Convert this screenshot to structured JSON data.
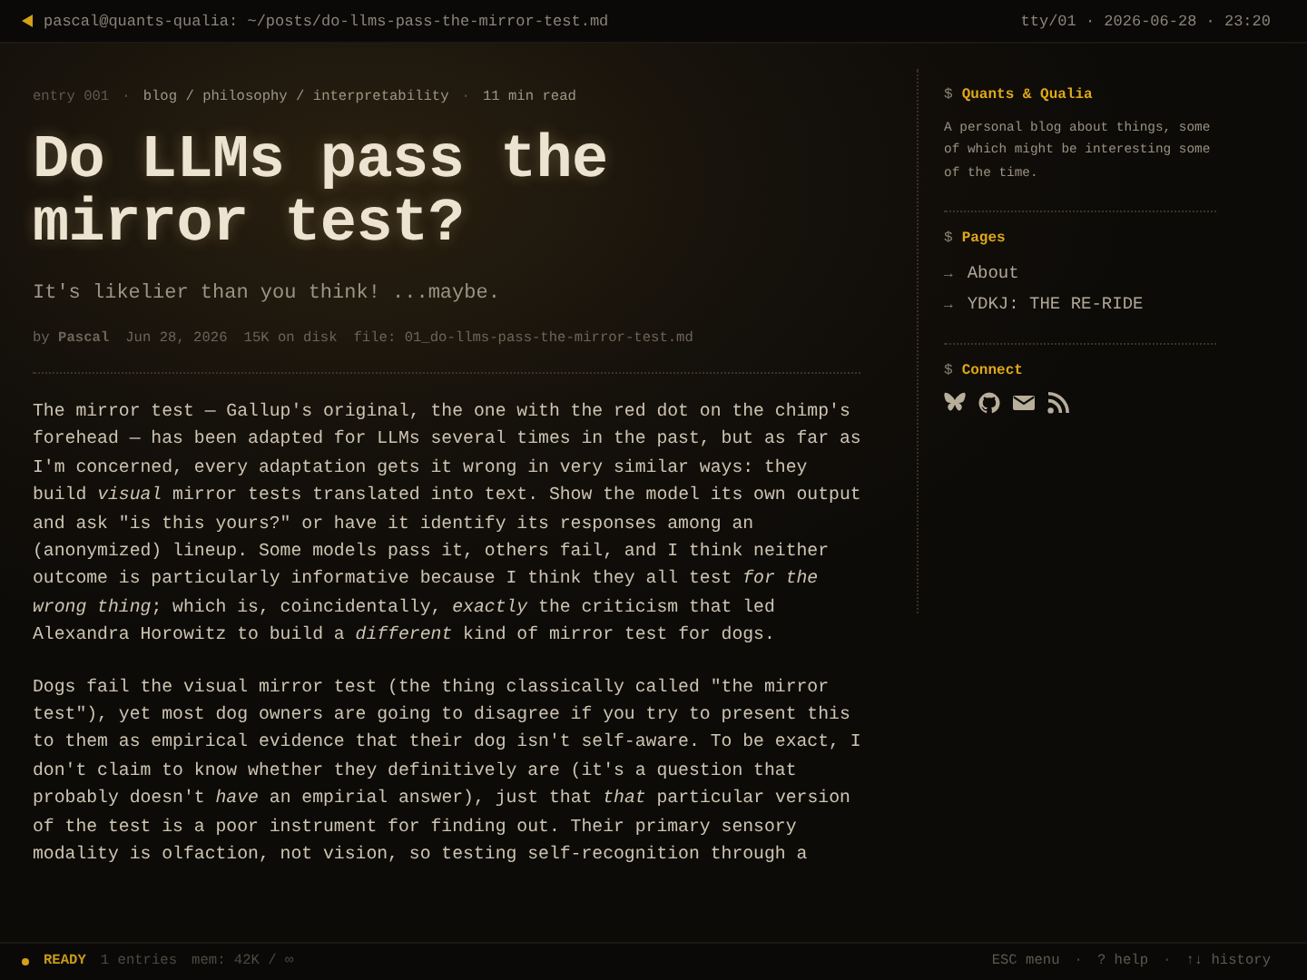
{
  "titlebar": {
    "path": "pascal@quants-qualia: ~/posts/do-llms-pass-the-mirror-test.md",
    "info": "tty/01 · 2026-06-28 · 23:20"
  },
  "breadcrumb": {
    "entry": "entry 001",
    "separator": "·",
    "path": "blog / philosophy / interpretability",
    "read_time": "11 min read"
  },
  "title": "Do LLMs pass the mirror test?",
  "subtitle": "It's likelier than you think! ...maybe.",
  "meta": {
    "author": "by **Pascal**",
    "date": "Jun 28, 2026",
    "size": "15K on disk",
    "file": "file: 01_do-llms-pass-the-mirror-test.md"
  },
  "paragraphs": [
    "The mirror test — Gallup's original, the one with the red dot on the chimp's forehead — has been adapted for LLMs several times in the past, but as far as I'm concerned, every adaptation gets it wrong in very similar ways: they build *visual* mirror tests translated into text. Show the model its own output and ask \"is this yours?\" or have it identify its responses among an (anonymized) lineup. Some models pass it, others fail, and I think neither outcome is particularly informative because I think they all test *for the wrong thing*; which is, coincidentally, *exactly* the criticism that led Alexandra Horowitz to build a *different* kind of mirror test for dogs.",
    "Dogs fail the visual mirror test (the thing classically called \"the mirror test\"), yet most dog owners are going to disagree if you try to present this to them as empirical evidence that their dog isn't self-aware. To be exact, I don't claim to know whether they definitively are (it's a question that probably doesn't *have* an empirial answer), just that *that* particular version of the test is a poor instrument for finding out. Their primary sensory modality is olfaction, not vision, so testing self-recognition through a"
  ],
  "sidebar": [
    {
      "kind": "text",
      "prompt": "$",
      "heading": "Quants & Qualia",
      "text": "A personal blog about things, some of which might be interesting some of the time."
    },
    {
      "kind": "links",
      "prompt": "$",
      "heading": "Pages",
      "items": [
        {
          "arrow": "→",
          "label": "About"
        },
        {
          "arrow": "→",
          "label": "YDKJ: THE RE-RIDE"
        }
      ]
    },
    {
      "kind": "icons",
      "prompt": "$",
      "heading": "Connect"
    }
  ],
  "status_bar": {
    "state": "READY",
    "entries": "1 entries",
    "memory": "mem: 42K / ∞",
    "hints": [
      "ESC menu",
      "?  help",
      "↑↓ history"
    ],
    "separator": "·"
  }
}
